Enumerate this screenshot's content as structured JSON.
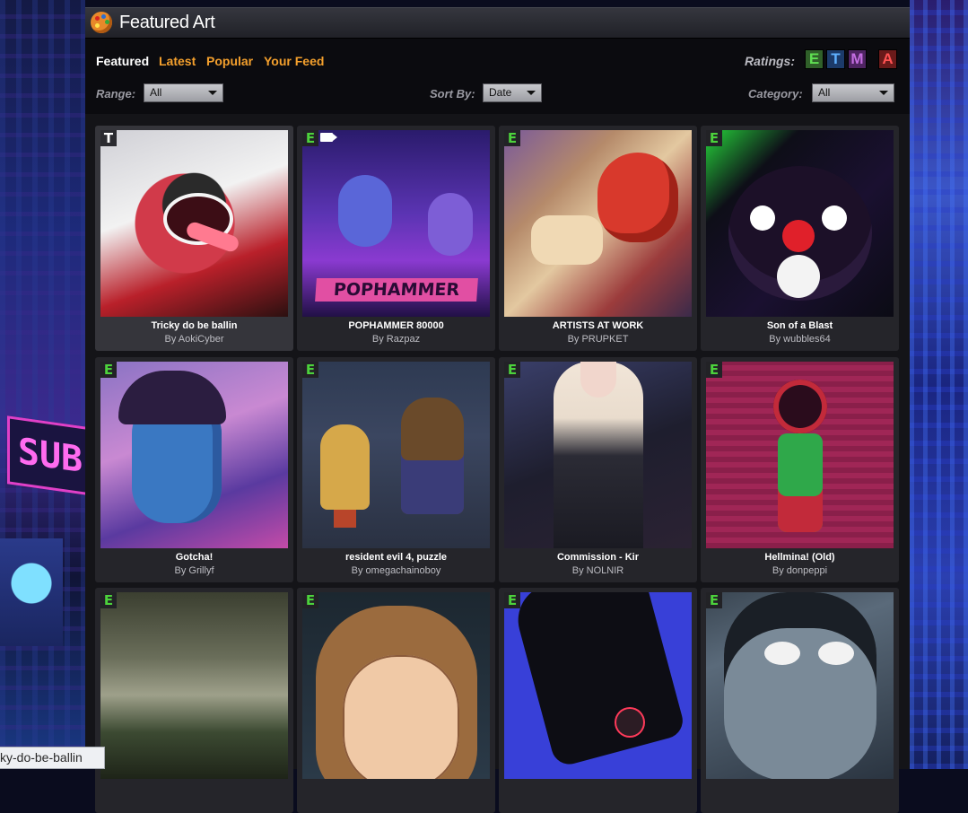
{
  "panel": {
    "title": "Featured Art",
    "icon": "palette-icon"
  },
  "tabs": [
    {
      "label": "Featured",
      "active": true
    },
    {
      "label": "Latest",
      "active": false
    },
    {
      "label": "Popular",
      "active": false
    },
    {
      "label": "Your Feed",
      "active": false
    }
  ],
  "ratings": {
    "label": "Ratings:",
    "buttons": [
      "E",
      "T",
      "M",
      "A"
    ]
  },
  "filters": {
    "range": {
      "label": "Range:",
      "value": "All"
    },
    "sort": {
      "label": "Sort By:",
      "value": "Date"
    },
    "category": {
      "label": "Category:",
      "value": "All"
    }
  },
  "side_sign": "SUB",
  "cards": [
    {
      "title": "Tricky do be ballin",
      "author": "By AokiCyber",
      "rating": "T",
      "video": false
    },
    {
      "title": "POPHAMMER 80000",
      "author": "By Razpaz",
      "rating": "E",
      "video": true
    },
    {
      "title": "ARTISTS AT WORK",
      "author": "By PRUPKET",
      "rating": "E",
      "video": false
    },
    {
      "title": "Son of a Blast",
      "author": "By wubbles64",
      "rating": "E",
      "video": false
    },
    {
      "title": "Gotcha!",
      "author": "By Grillyf",
      "rating": "E",
      "video": false
    },
    {
      "title": "resident evil 4, puzzle",
      "author": "By omegachainoboy",
      "rating": "E",
      "video": false
    },
    {
      "title": "Commission - Kir",
      "author": "By NOLNIR",
      "rating": "E",
      "video": false
    },
    {
      "title": "Hellmina! (Old)",
      "author": "By donpeppi",
      "rating": "E",
      "video": false
    },
    {
      "title": "",
      "author": "",
      "rating": "E",
      "video": false
    },
    {
      "title": "",
      "author": "",
      "rating": "E",
      "video": false
    },
    {
      "title": "",
      "author": "",
      "rating": "E",
      "video": false
    },
    {
      "title": "",
      "author": "",
      "rating": "E",
      "video": false
    }
  ],
  "status_tooltip": "ky-do-be-ballin"
}
